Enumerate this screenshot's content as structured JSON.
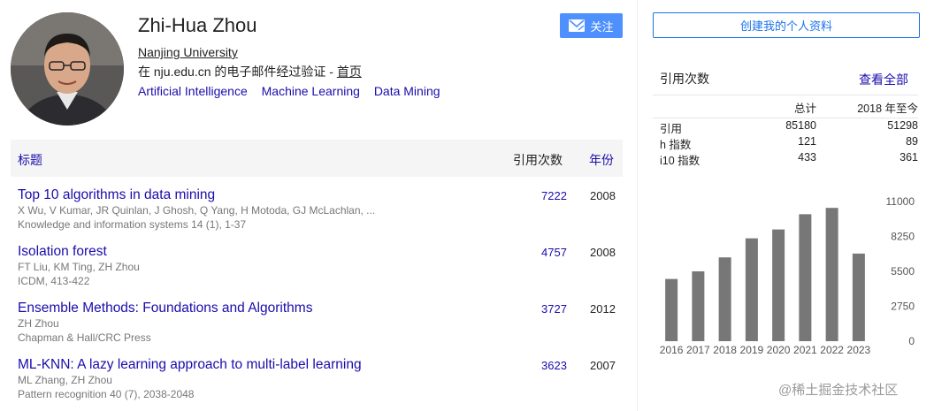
{
  "profile": {
    "name": "Zhi-Hua Zhou",
    "affiliation": "Nanjing University",
    "verified_prefix": "在 nju.edu.cn 的电子邮件经过验证 - ",
    "homepage_label": "首页",
    "interests": [
      "Artificial Intelligence",
      "Machine Learning",
      "Data Mining"
    ],
    "follow_label": "关注"
  },
  "table": {
    "header_title": "标题",
    "header_cites": "引用次数",
    "header_year": "年份",
    "rows": [
      {
        "title": "Top 10 algorithms in data mining",
        "authors": "X Wu, V Kumar, JR Quinlan, J Ghosh, Q Yang, H Motoda, GJ McLachlan, ...",
        "venue": "Knowledge and information systems 14 (1), 1-37",
        "cites": "7222",
        "year": "2008"
      },
      {
        "title": "Isolation forest",
        "authors": "FT Liu, KM Ting, ZH Zhou",
        "venue": "ICDM, 413-422",
        "cites": "4757",
        "year": "2008"
      },
      {
        "title": "Ensemble Methods: Foundations and Algorithms",
        "authors": "ZH Zhou",
        "venue": "Chapman & Hall/CRC Press",
        "cites": "3727",
        "year": "2012"
      },
      {
        "title": "ML-KNN: A lazy learning approach to multi-label learning",
        "authors": "ML Zhang, ZH Zhou",
        "venue": "Pattern recognition 40 (7), 2038-2048",
        "cites": "3623",
        "year": "2007"
      }
    ]
  },
  "sidebar": {
    "create_label": "创建我的个人资料",
    "cited_by": "引用次数",
    "view_all": "查看全部",
    "col_total": "总计",
    "col_since": "2018 年至今",
    "stats": [
      {
        "label": "引用",
        "total": "85180",
        "since": "51298"
      },
      {
        "label": "h 指数",
        "total": "121",
        "since": "89"
      },
      {
        "label": "i10 指数",
        "total": "433",
        "since": "361"
      }
    ]
  },
  "chart_data": {
    "type": "bar",
    "categories": [
      "2016",
      "2017",
      "2018",
      "2019",
      "2020",
      "2021",
      "2022",
      "2023"
    ],
    "values": [
      4900,
      5500,
      6600,
      8100,
      8800,
      10000,
      10500,
      6900
    ],
    "yticks": [
      0,
      2750,
      5500,
      8250,
      11000
    ],
    "ylim": [
      0,
      11000
    ],
    "bar_color": "#777777"
  },
  "watermark": "@稀土掘金技术社区",
  "colors": {
    "link": "#1a0dab",
    "button": "#4d90fe"
  }
}
